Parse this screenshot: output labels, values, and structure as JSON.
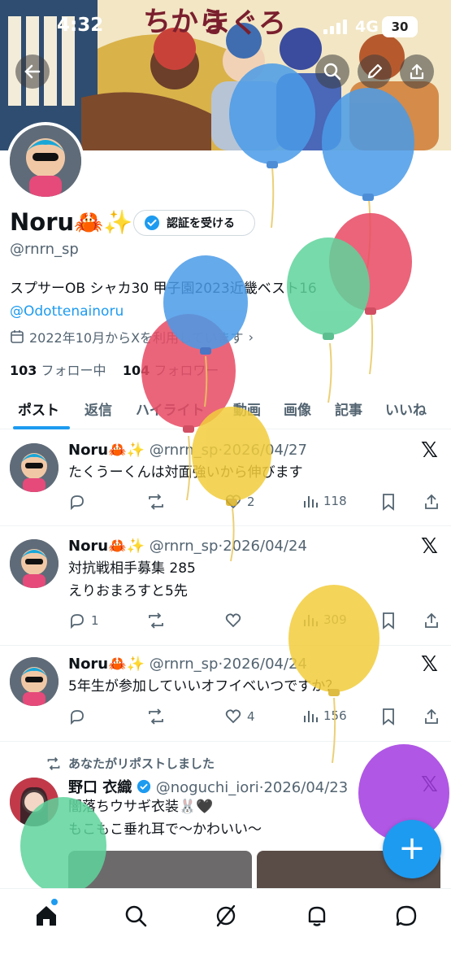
{
  "status_bar": {
    "time": "4:32",
    "network": "4G",
    "battery": "30"
  },
  "banner": {
    "art_text_1": "ちから",
    "art_text_2": "まぐろ"
  },
  "header_icons": [
    "back-arrow-icon",
    "search-icon",
    "edit-icon",
    "share-icon"
  ],
  "profile": {
    "name": "Noru🦀✨",
    "verify_button": "認証を受ける",
    "handle": "@rnrn_sp",
    "bio_line1": "スプサーOB シャカ30 甲子園2023近畿ベスト16",
    "bio_link": "@Odottenainoru",
    "joined": "2022年10月からXを利用しています",
    "following_count": "103",
    "following_label": "フォロー中",
    "followers_count": "104",
    "followers_label": "フォロワー"
  },
  "tabs": [
    "ポスト",
    "返信",
    "ハイライト",
    "動画",
    "画像",
    "記事",
    "いいね"
  ],
  "posts": [
    {
      "name": "Noru🦀✨",
      "meta": "@rnrn_sp·2026/04/27",
      "text": "たくうーくんは対面強いから伸びます",
      "replies": "",
      "reposts": "",
      "likes": "2",
      "views": "118"
    },
    {
      "name": "Noru🦀✨",
      "meta": "@rnrn_sp·2026/04/24",
      "text": "対抗戦相手募集 285\nえりおまろすと5先",
      "replies": "1",
      "reposts": "",
      "likes": "",
      "views": "309"
    },
    {
      "name": "Noru🦀✨",
      "meta": "@rnrn_sp·2026/04/24",
      "text": "5年生が参加していいオフイベいつですか？",
      "replies": "",
      "reposts": "",
      "likes": "4",
      "views": "156"
    },
    {
      "repost_note": "あなたがリポストしました",
      "name": "野口 衣織",
      "meta": "@noguchi_iori·2026/04/23",
      "text": "闇落ちウサギ衣装🐰🖤\nもこもこ垂れ耳で〜かわいい〜"
    }
  ],
  "fab_label": "+",
  "bottom_nav": [
    "home-icon",
    "search-icon",
    "grok-icon",
    "notifications-icon",
    "messages-icon"
  ],
  "colors": {
    "accent": "#1d9bf0",
    "text": "#0f1419",
    "muted": "#536471"
  }
}
